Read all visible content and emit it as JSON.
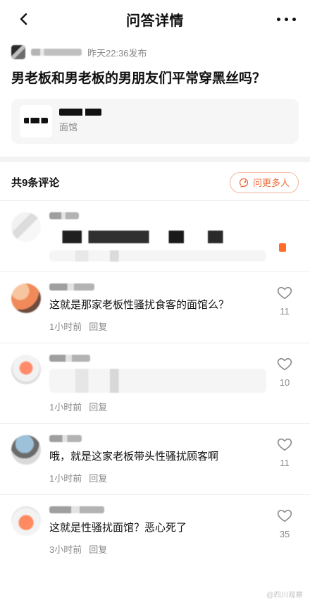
{
  "header": {
    "title": "问答详情",
    "back_icon": "back-chevron",
    "more_icon": "more-dots"
  },
  "question": {
    "meta_time": "昨天22:36发布",
    "title": "男老板和男老板的男朋友们平常穿黑丝吗？",
    "store": {
      "type": "面馆"
    }
  },
  "comments_section": {
    "count_label": "共9条评论",
    "ask_more_label": "问更多人",
    "ask_icon": "chat-refresh-icon"
  },
  "comments": [
    {
      "text": "",
      "time": "",
      "reply": "",
      "likes": ""
    },
    {
      "text": "这就是那家老板性骚扰食客的面馆么？",
      "time": "1小时前",
      "reply": "回复",
      "likes": "11"
    },
    {
      "text": "",
      "time": "1小时前",
      "reply": "回复",
      "likes": "10"
    },
    {
      "text": "哦，就是这家老板带头性骚扰顾客啊",
      "time": "1小时前",
      "reply": "回复",
      "likes": "11"
    },
    {
      "text": "这就是性骚扰面馆？恶心死了",
      "time": "3小时前",
      "reply": "回复",
      "likes": "35"
    }
  ],
  "watermark": "@四川观察",
  "colors": {
    "accent": "#f06b3a",
    "muted": "#8a8a8a",
    "divider": "#efefef",
    "card": "#f6f6f6"
  }
}
